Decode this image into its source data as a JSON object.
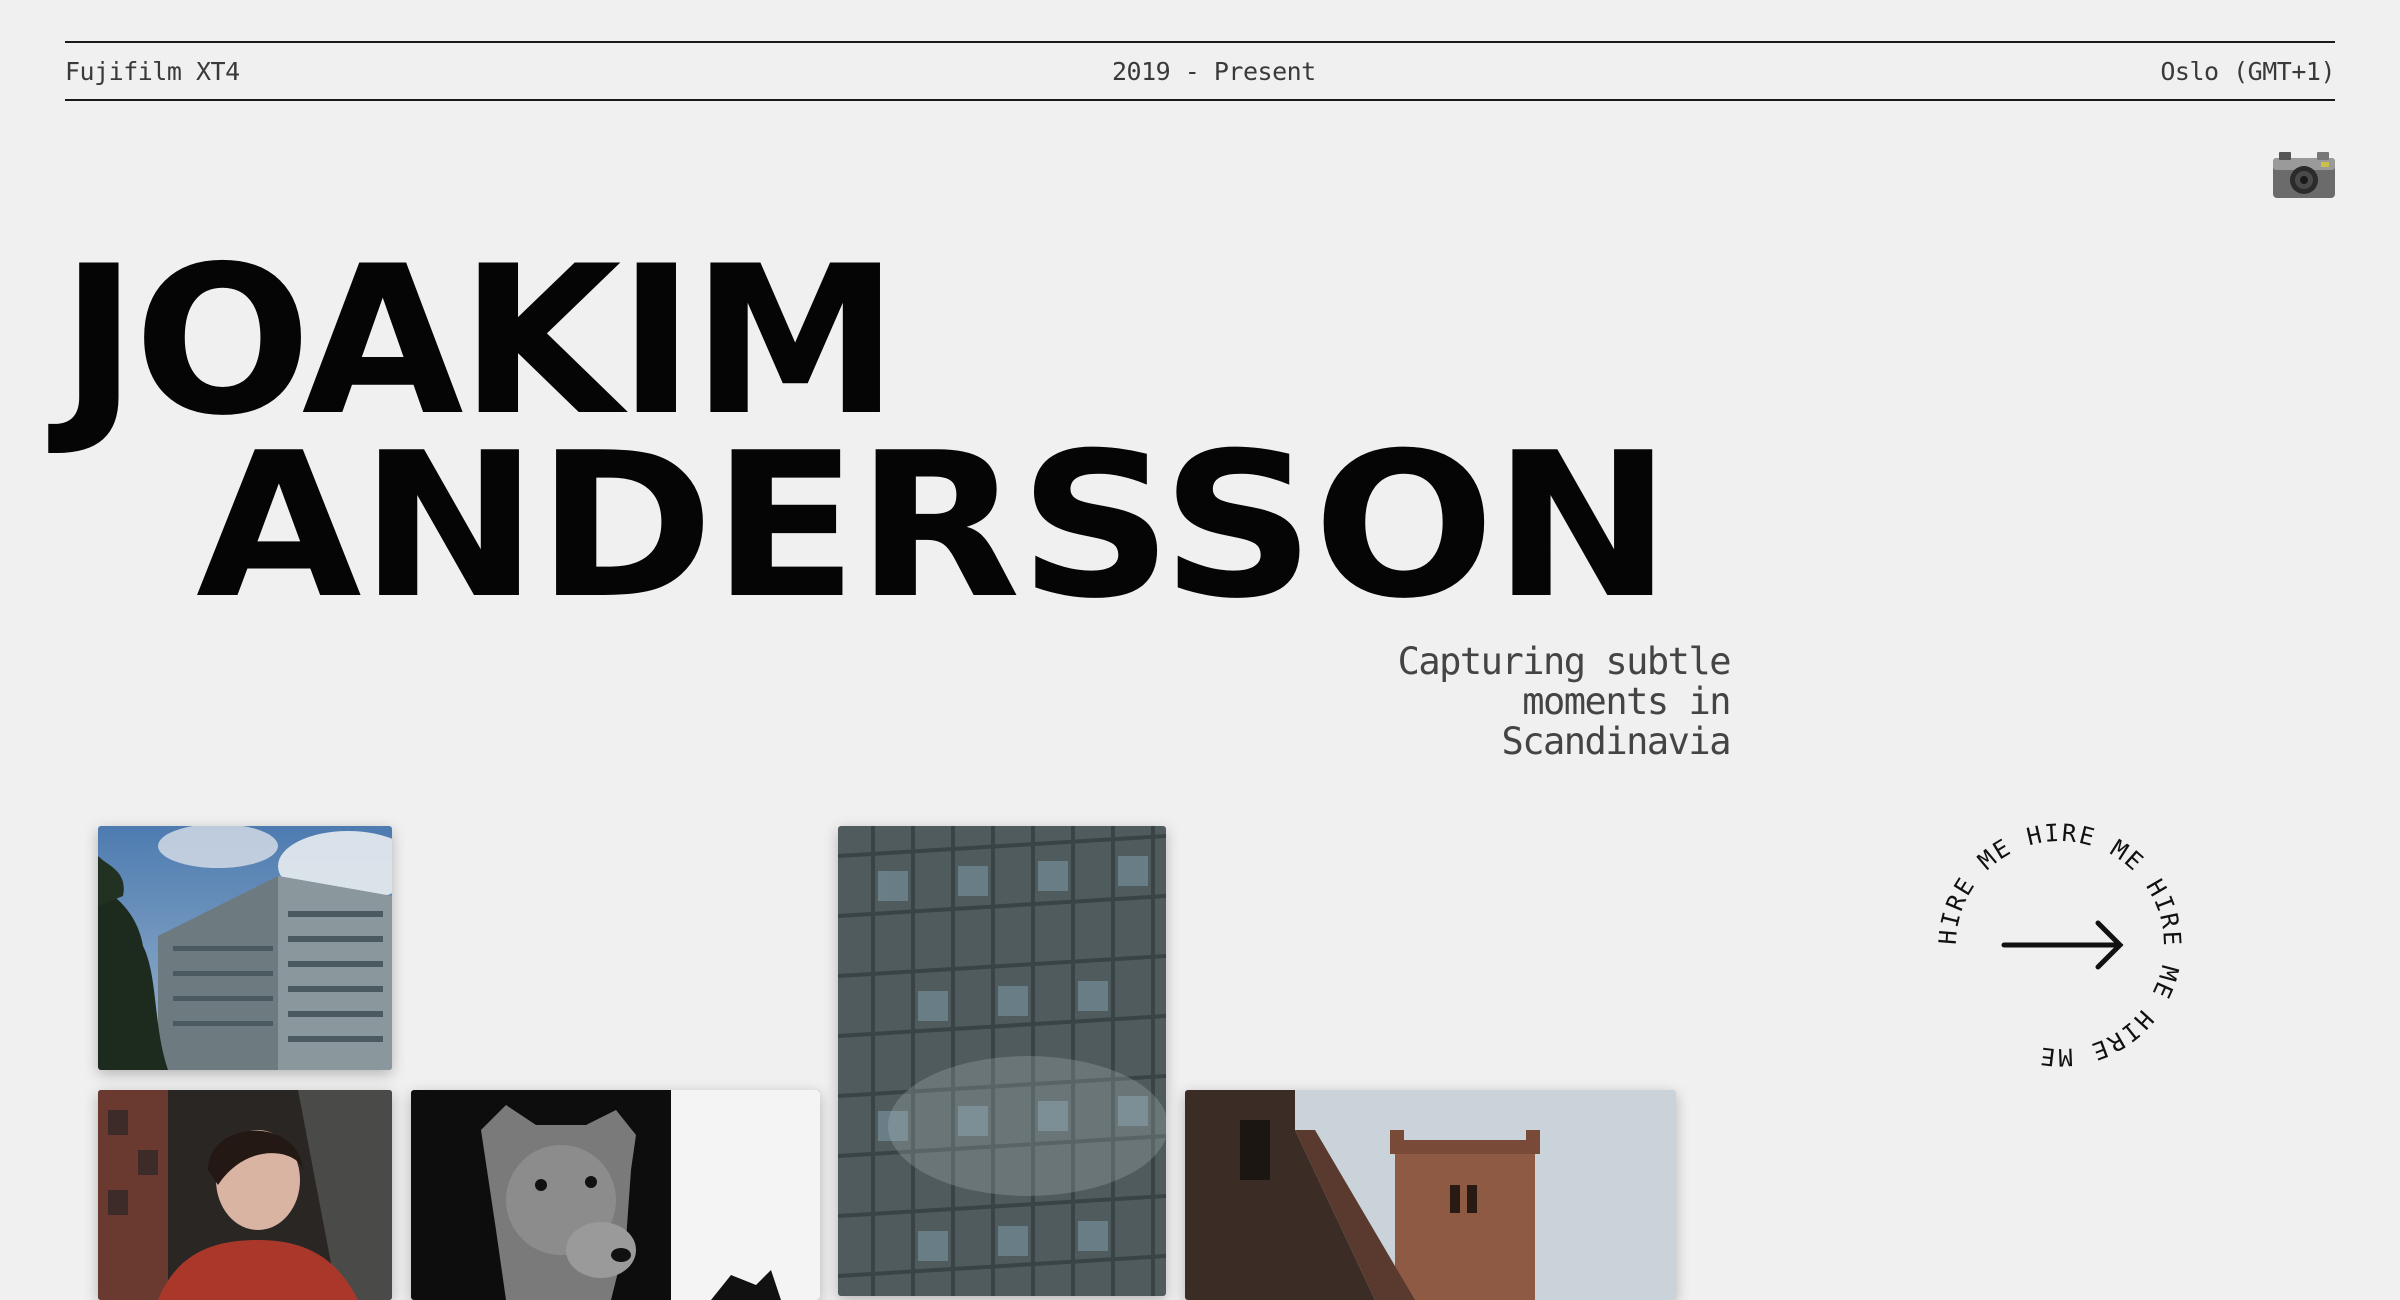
{
  "header": {
    "camera": "Fujifilm XT4",
    "years": "2019 - Present",
    "location": "Oslo (GMT+1)"
  },
  "hero": {
    "first_name": "JOAKIM",
    "last_name": "ANDERSSON",
    "tagline_lines": [
      "Capturing subtle",
      "moments in",
      "Scandinavia"
    ]
  },
  "hire_badge": {
    "text": "HIRE ME HIRE ME HIRE ME HIRE ME"
  },
  "icons": {
    "camera": "camera-icon",
    "arrow": "arrow-right-icon"
  },
  "colors": {
    "background": "#f0f0f0",
    "text": "#050505",
    "muted": "#3a3a3a"
  }
}
